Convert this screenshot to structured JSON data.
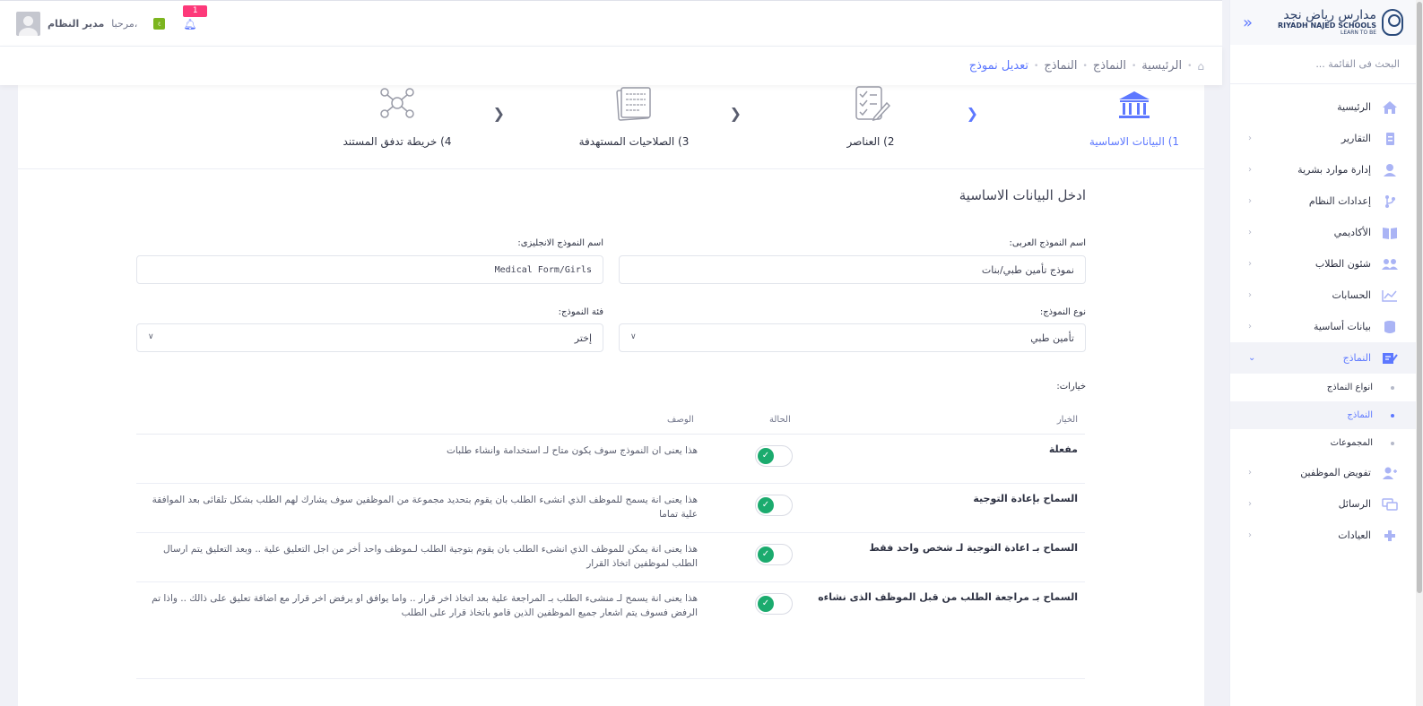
{
  "header": {
    "greeting": "مرحبا،",
    "user_name": "مدير النظام",
    "notification_count": "1",
    "lang_badge": "ع"
  },
  "breadcrumb": {
    "items": [
      "الرئيسية",
      "النماذج",
      "النماذج"
    ],
    "current": "تعديل نموذج"
  },
  "sidebar": {
    "logo_ar": "مدارس رياض نجد",
    "logo_en": "RIYADH NAJED SCHOOLS",
    "logo_tag": "LEARN TO BE",
    "search_placeholder": "البحث فى القائمة ...",
    "items": [
      {
        "label": "الرئيسية",
        "icon": "home-icon"
      },
      {
        "label": "التقارير",
        "icon": "report-icon"
      },
      {
        "label": "إدارة موارد بشرية",
        "icon": "user-icon"
      },
      {
        "label": "إعدادات النظام",
        "icon": "settings-icon"
      },
      {
        "label": "الأكاديمي",
        "icon": "book-icon"
      },
      {
        "label": "شئون الطلاب",
        "icon": "students-icon"
      },
      {
        "label": "الحسابات",
        "icon": "chart-icon"
      },
      {
        "label": "بيانات أساسية",
        "icon": "database-icon"
      },
      {
        "label": "النماذج",
        "icon": "forms-icon"
      }
    ],
    "sub_items": [
      "انواع النماذج",
      "النماذج",
      "المجموعات"
    ],
    "items_after": [
      {
        "label": "تفويض الموظفين",
        "icon": "delegate-icon"
      },
      {
        "label": "الرسائل",
        "icon": "messages-icon"
      },
      {
        "label": "العيادات",
        "icon": "clinic-icon"
      }
    ]
  },
  "wizard": {
    "steps": [
      {
        "label": "1) البيانات الاساسية",
        "icon": "bank-icon"
      },
      {
        "label": "2) العناصر",
        "icon": "checklist-icon"
      },
      {
        "label": "3) الصلاحيات المستهدفة",
        "icon": "document-icon"
      },
      {
        "label": "4) خريطة تدفق المستند",
        "icon": "flow-icon"
      }
    ]
  },
  "form": {
    "title": "ادخل البيانات الاساسية",
    "arabic_name_label": "اسم النموذج العربى:",
    "arabic_name_value": "نموذج تأمين طبي/بنات",
    "english_name_label": "اسم النموذج الانجليزى:",
    "english_name_value": "Medical Form/Girls",
    "type_label": "نوع النموذج:",
    "type_value": "تأمين طبي",
    "category_label": "فئة النموذج:",
    "category_value": "إختر",
    "options_label": "خيارات:"
  },
  "options_table": {
    "headers": {
      "option": "الخيار",
      "status": "الحالة",
      "description": "الوصف"
    },
    "rows": [
      {
        "option": "مفعلة",
        "enabled": true,
        "description": "هذا يعنى ان النموذج سوف يكون متاح لـ استخدامة وانشاء طلبات"
      },
      {
        "option": "السماح بإعادة التوجية",
        "enabled": true,
        "description": "هذا يعنى انة يسمح للموظف الذي انشىء الطلب بان يقوم بتحديد مجموعة من الموظفين سوف يشارك لهم الطلب بشكل تلقائى بعد الموافقة علية تماما"
      },
      {
        "option": "السماح بـ اعادة التوجية لـ شخص واحد فقط",
        "enabled": true,
        "description": "هذا يعنى انة يمكن للموظف الذي انشىء الطلب بان يقوم بتوجية الطلب لـموظف واحد أخر من اجل التعليق علية .. وبعد التعليق يتم ارسال الطلب لموظفين اتخاذ القرار"
      },
      {
        "option": "السماح بـ مراجعة الطلب من قبل الموظف الذى نشاءه",
        "enabled": true,
        "description": "هذا يعنى انة يسمح لـ منشىء الطلب بـ المراجعة علية بعد اتخاذ اخر قرار .. واما يوافق او يرفض اخر قرار مع اضافة تعليق على ذالك .. واذا تم الرفض فسوف يتم اشعار جميع الموظفين الذين قامو باتخاذ قرار على الطلب"
      }
    ]
  },
  "colors": {
    "accent": "#5d78ff",
    "toggle_on": "#1bab6e",
    "badge": "#fd397a"
  }
}
